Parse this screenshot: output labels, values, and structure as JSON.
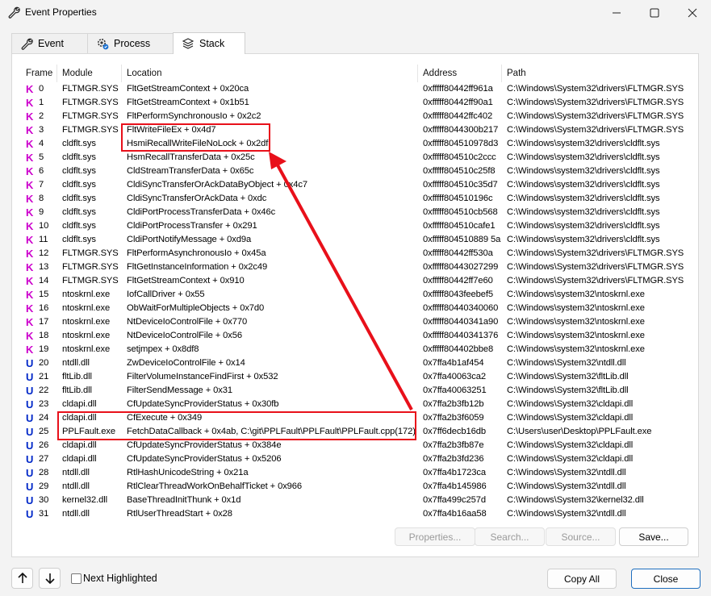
{
  "window": {
    "title": "Event Properties"
  },
  "tabs": [
    {
      "label": "Event",
      "icon": "wrench-icon"
    },
    {
      "label": "Process",
      "icon": "gear-process-icon"
    },
    {
      "label": "Stack",
      "icon": "stack-icon"
    }
  ],
  "active_tab": "Stack",
  "columns": [
    "Frame",
    "Module",
    "Location",
    "Address",
    "Path"
  ],
  "rows": [
    {
      "mode": "K",
      "frame": "0",
      "module": "FLTMGR.SYS",
      "location": "FltGetStreamContext + 0x20ca",
      "address": "0xfffff80442ff961a",
      "path": "C:\\Windows\\System32\\drivers\\FLTMGR.SYS"
    },
    {
      "mode": "K",
      "frame": "1",
      "module": "FLTMGR.SYS",
      "location": "FltGetStreamContext + 0x1b51",
      "address": "0xfffff80442ff90a1",
      "path": "C:\\Windows\\System32\\drivers\\FLTMGR.SYS"
    },
    {
      "mode": "K",
      "frame": "2",
      "module": "FLTMGR.SYS",
      "location": "FltPerformSynchronousIo + 0x2c2",
      "address": "0xfffff80442ffc402",
      "path": "C:\\Windows\\System32\\drivers\\FLTMGR.SYS"
    },
    {
      "mode": "K",
      "frame": "3",
      "module": "FLTMGR.SYS",
      "location": "FltWriteFileEx + 0x4d7",
      "address": "0xfffff8044300b217",
      "path": "C:\\Windows\\System32\\drivers\\FLTMGR.SYS"
    },
    {
      "mode": "K",
      "frame": "4",
      "module": "cldflt.sys",
      "location": "HsmiRecallWriteFileNoLock + 0x2df",
      "address": "0xfffff804510978d3",
      "path": "C:\\Windows\\system32\\drivers\\cldflt.sys"
    },
    {
      "mode": "K",
      "frame": "5",
      "module": "cldflt.sys",
      "location": "HsmRecallTransferData + 0x25c",
      "address": "0xfffff804510c2ccc",
      "path": "C:\\Windows\\system32\\drivers\\cldflt.sys"
    },
    {
      "mode": "K",
      "frame": "6",
      "module": "cldflt.sys",
      "location": "CldStreamTransferData + 0x65c",
      "address": "0xfffff804510c25f8",
      "path": "C:\\Windows\\system32\\drivers\\cldflt.sys"
    },
    {
      "mode": "K",
      "frame": "7",
      "module": "cldflt.sys",
      "location": "CldiSyncTransferOrAckDataByObject + 0x4c7",
      "address": "0xfffff804510c35d7",
      "path": "C:\\Windows\\system32\\drivers\\cldflt.sys"
    },
    {
      "mode": "K",
      "frame": "8",
      "module": "cldflt.sys",
      "location": "CldiSyncTransferOrAckData + 0xdc",
      "address": "0xfffff804510196c",
      "path": "C:\\Windows\\system32\\drivers\\cldflt.sys"
    },
    {
      "mode": "K",
      "frame": "9",
      "module": "cldflt.sys",
      "location": "CldiPortProcessTransferData + 0x46c",
      "address": "0xfffff804510cb568",
      "path": "C:\\Windows\\system32\\drivers\\cldflt.sys"
    },
    {
      "mode": "K",
      "frame": "10",
      "module": "cldflt.sys",
      "location": "CldiPortProcessTransfer + 0x291",
      "address": "0xfffff804510cafe1",
      "path": "C:\\Windows\\system32\\drivers\\cldflt.sys"
    },
    {
      "mode": "K",
      "frame": "11",
      "module": "cldflt.sys",
      "location": "CldiPortNotifyMessage + 0xd9a",
      "address": "0xfffff804510889 5a",
      "path": "C:\\Windows\\system32\\drivers\\cldflt.sys"
    },
    {
      "mode": "K",
      "frame": "12",
      "module": "FLTMGR.SYS",
      "location": "FltPerformAsynchronousIo + 0x45a",
      "address": "0xfffff80442ff530a",
      "path": "C:\\Windows\\System32\\drivers\\FLTMGR.SYS"
    },
    {
      "mode": "K",
      "frame": "13",
      "module": "FLTMGR.SYS",
      "location": "FltGetInstanceInformation + 0x2c49",
      "address": "0xfffff80443027299",
      "path": "C:\\Windows\\System32\\drivers\\FLTMGR.SYS"
    },
    {
      "mode": "K",
      "frame": "14",
      "module": "FLTMGR.SYS",
      "location": "FltGetStreamContext + 0x910",
      "address": "0xfffff80442ff7e60",
      "path": "C:\\Windows\\System32\\drivers\\FLTMGR.SYS"
    },
    {
      "mode": "K",
      "frame": "15",
      "module": "ntoskrnl.exe",
      "location": "IofCallDriver + 0x55",
      "address": "0xfffff8043feebef5",
      "path": "C:\\Windows\\system32\\ntoskrnl.exe"
    },
    {
      "mode": "K",
      "frame": "16",
      "module": "ntoskrnl.exe",
      "location": "ObWaitForMultipleObjects + 0x7d0",
      "address": "0xfffff80440340060",
      "path": "C:\\Windows\\system32\\ntoskrnl.exe"
    },
    {
      "mode": "K",
      "frame": "17",
      "module": "ntoskrnl.exe",
      "location": "NtDeviceIoControlFile + 0x770",
      "address": "0xfffff80440341a90",
      "path": "C:\\Windows\\system32\\ntoskrnl.exe"
    },
    {
      "mode": "K",
      "frame": "18",
      "module": "ntoskrnl.exe",
      "location": "NtDeviceIoControlFile + 0x56",
      "address": "0xfffff80440341376",
      "path": "C:\\Windows\\system32\\ntoskrnl.exe"
    },
    {
      "mode": "K",
      "frame": "19",
      "module": "ntoskrnl.exe",
      "location": "setjmpex + 0x8df8",
      "address": "0xfffff804402bbe8",
      "path": "C:\\Windows\\system32\\ntoskrnl.exe"
    },
    {
      "mode": "U",
      "frame": "20",
      "module": "ntdll.dll",
      "location": "ZwDeviceIoControlFile + 0x14",
      "address": "0x7ffa4b1af454",
      "path": "C:\\Windows\\System32\\ntdll.dll"
    },
    {
      "mode": "U",
      "frame": "21",
      "module": "fltLib.dll",
      "location": "FilterVolumeInstanceFindFirst + 0x532",
      "address": "0x7ffa40063ca2",
      "path": "C:\\Windows\\System32\\fltLib.dll"
    },
    {
      "mode": "U",
      "frame": "22",
      "module": "fltLib.dll",
      "location": "FilterSendMessage + 0x31",
      "address": "0x7ffa40063251",
      "path": "C:\\Windows\\System32\\fltLib.dll"
    },
    {
      "mode": "U",
      "frame": "23",
      "module": "cldapi.dll",
      "location": "CfUpdateSyncProviderStatus + 0x30fb",
      "address": "0x7ffa2b3fb12b",
      "path": "C:\\Windows\\System32\\cldapi.dll"
    },
    {
      "mode": "U",
      "frame": "24",
      "module": "cldapi.dll",
      "location": "CfExecute + 0x349",
      "address": "0x7ffa2b3f6059",
      "path": "C:\\Windows\\System32\\cldapi.dll"
    },
    {
      "mode": "U",
      "frame": "25",
      "module": "PPLFault.exe",
      "location": "FetchDataCallback + 0x4ab, C:\\git\\PPLFault\\PPLFault\\PPLFault.cpp(172)",
      "address": "0x7ff6decb16db",
      "path": "C:\\Users\\user\\Desktop\\PPLFault.exe"
    },
    {
      "mode": "U",
      "frame": "26",
      "module": "cldapi.dll",
      "location": "CfUpdateSyncProviderStatus + 0x384e",
      "address": "0x7ffa2b3fb87e",
      "path": "C:\\Windows\\System32\\cldapi.dll"
    },
    {
      "mode": "U",
      "frame": "27",
      "module": "cldapi.dll",
      "location": "CfUpdateSyncProviderStatus + 0x5206",
      "address": "0x7ffa2b3fd236",
      "path": "C:\\Windows\\System32\\cldapi.dll"
    },
    {
      "mode": "U",
      "frame": "28",
      "module": "ntdll.dll",
      "location": "RtlHashUnicodeString + 0x21a",
      "address": "0x7ffa4b1723ca",
      "path": "C:\\Windows\\System32\\ntdll.dll"
    },
    {
      "mode": "U",
      "frame": "29",
      "module": "ntdll.dll",
      "location": "RtlClearThreadWorkOnBehalfTicket + 0x966",
      "address": "0x7ffa4b145986",
      "path": "C:\\Windows\\System32\\ntdll.dll"
    },
    {
      "mode": "U",
      "frame": "30",
      "module": "kernel32.dll",
      "location": "BaseThreadInitThunk + 0x1d",
      "address": "0x7ffa499c257d",
      "path": "C:\\Windows\\System32\\kernel32.dll"
    },
    {
      "mode": "U",
      "frame": "31",
      "module": "ntdll.dll",
      "location": "RtlUserThreadStart + 0x28",
      "address": "0x7ffa4b16aa58",
      "path": "C:\\Windows\\System32\\ntdll.dll"
    }
  ],
  "buttons": {
    "properties": "Properties...",
    "search": "Search...",
    "source": "Source...",
    "save": "Save...",
    "copy_all": "Copy All",
    "close": "Close"
  },
  "next_highlighted": {
    "label": "Next Highlighted",
    "checked": false
  },
  "colors": {
    "kernel_mode": "#cc00cc",
    "user_mode": "#0028c8",
    "annotation": "#e8101a"
  }
}
